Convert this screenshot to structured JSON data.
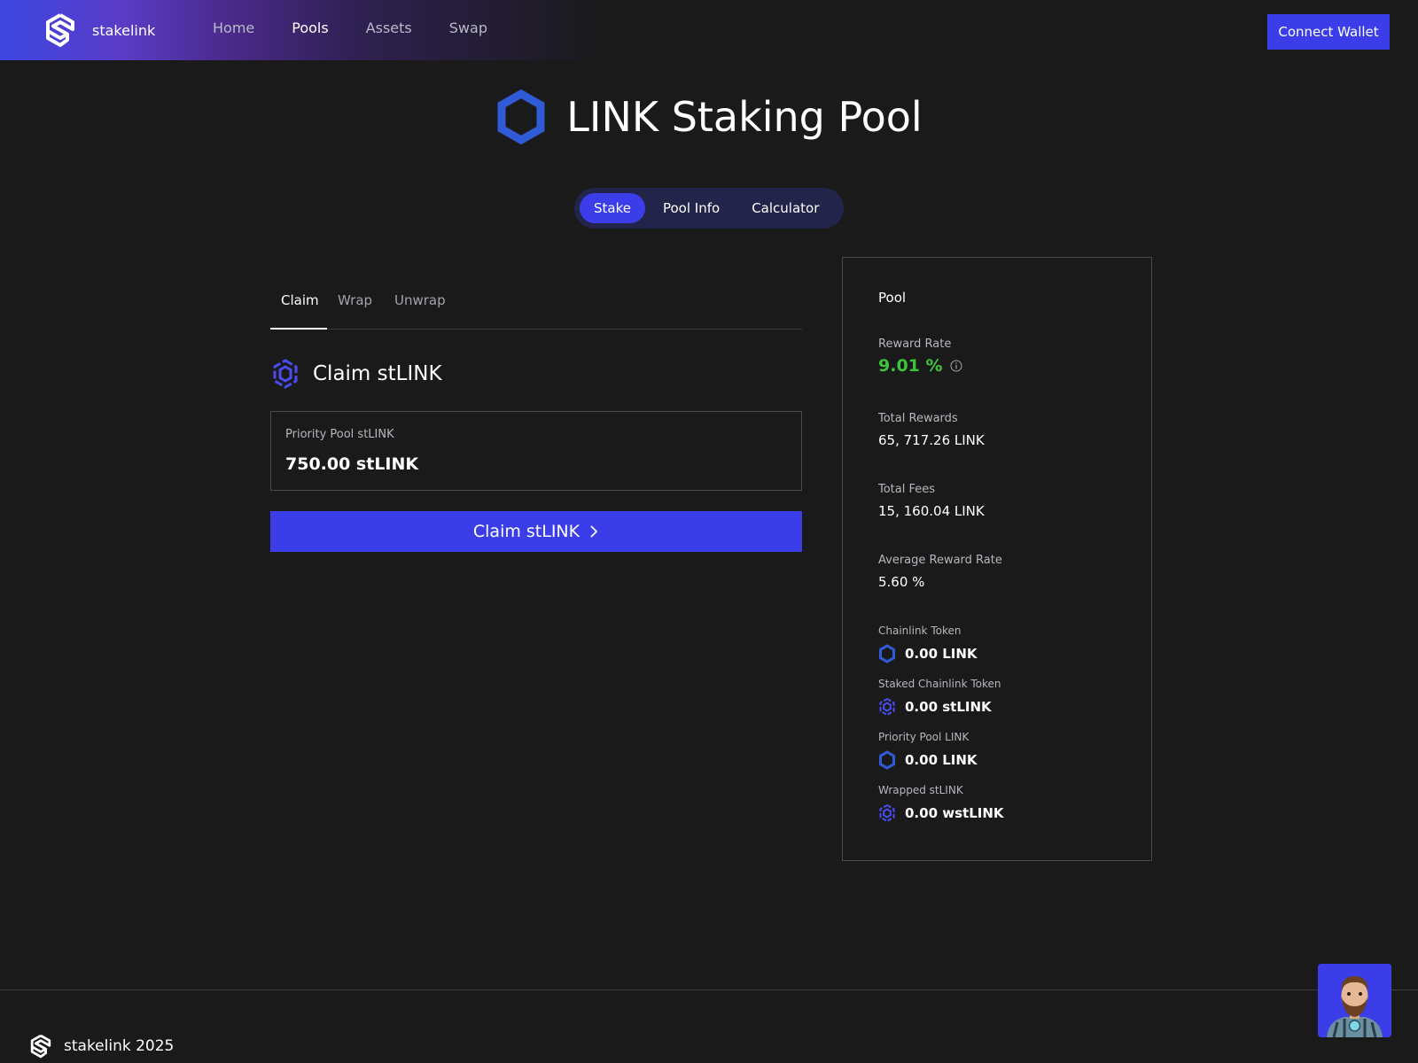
{
  "header": {
    "brand": "stakelink",
    "nav": [
      "Home",
      "Pools",
      "Assets",
      "Swap"
    ],
    "active_nav": "Pools",
    "connect_label": "Connect Wallet"
  },
  "title": "LINK Staking Pool",
  "main_tabs": [
    {
      "label": "Stake",
      "active": true
    },
    {
      "label": "Pool Info",
      "active": false
    },
    {
      "label": "Calculator",
      "active": false
    }
  ],
  "sub_tabs": [
    {
      "label": "Claim",
      "active": true
    },
    {
      "label": "Wrap",
      "active": false
    },
    {
      "label": "Unwrap",
      "active": false
    }
  ],
  "claim": {
    "heading": "Claim stLINK",
    "balance_label": "Priority Pool stLINK",
    "balance_value": "750.00 stLINK",
    "button_label": "Claim stLINK"
  },
  "pool": {
    "title": "Pool",
    "stats": [
      {
        "label": "Reward Rate",
        "value": "9.01 %"
      },
      {
        "label": "Total Rewards",
        "value": "65, 717.26 LINK"
      },
      {
        "label": "Total Fees",
        "value": "15, 160.04 LINK"
      },
      {
        "label": "Average Reward Rate",
        "value": "5.60 %"
      }
    ],
    "tokens": [
      {
        "label": "Chainlink Token",
        "value": "0.00 LINK",
        "icon": "link-hexagon-icon"
      },
      {
        "label": "Staked Chainlink Token",
        "value": "0.00 stLINK",
        "icon": "stlink-icon"
      },
      {
        "label": "Priority Pool LINK",
        "value": "0.00 LINK",
        "icon": "link-hexagon-icon"
      },
      {
        "label": "Wrapped stLINK",
        "value": "0.00 wstLINK",
        "icon": "stlink-icon"
      }
    ]
  },
  "footer": {
    "brand": "stakelink 2025"
  },
  "colors": {
    "accent": "#3b3ee8",
    "background": "#1a1a1b",
    "positive": "#3ec43a",
    "link_blue": "#2f5bd6"
  }
}
